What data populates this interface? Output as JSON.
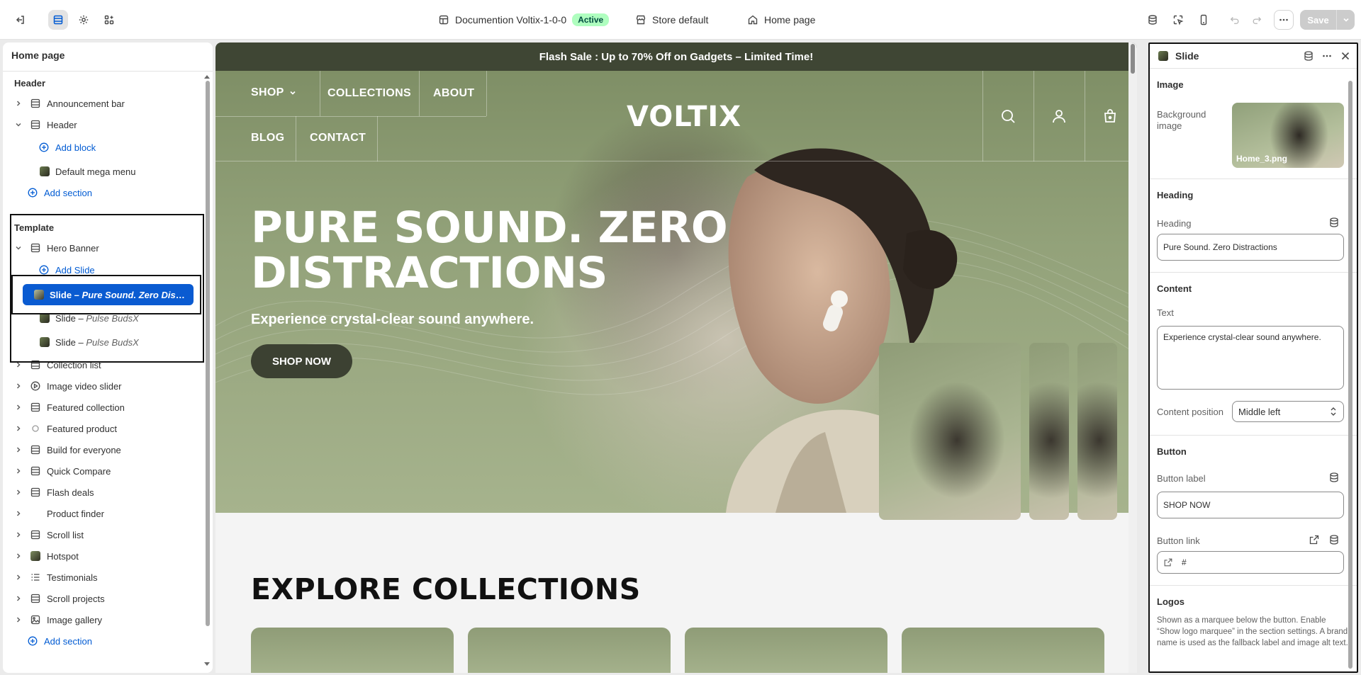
{
  "topbar": {
    "theme_name": "Documention Voltix-1-0-0",
    "theme_status": "Active",
    "store": "Store default",
    "page": "Home page",
    "save_label": "Save"
  },
  "sidebar": {
    "title": "Home page",
    "header_group": "Header",
    "header_items": [
      {
        "label": "Announcement bar"
      },
      {
        "label": "Header"
      }
    ],
    "header_children": {
      "add_block": "Add block",
      "mega_menu": "Default mega menu"
    },
    "add_section": "Add section",
    "template_group": "Template",
    "hero": "Hero Banner",
    "add_slide": "Add Slide",
    "slides": [
      {
        "prefix": "Slide – ",
        "name": "Pure Sound. Zero Distra..."
      },
      {
        "prefix": "Slide – ",
        "name": "Pulse BudsX"
      },
      {
        "prefix": "Slide – ",
        "name": "Pulse BudsX"
      }
    ],
    "sections": [
      {
        "label": "Collection list",
        "icon": "layout-icon"
      },
      {
        "label": "Image video slider",
        "icon": "play-circle-icon"
      },
      {
        "label": "Featured collection",
        "icon": "layout-icon"
      },
      {
        "label": "Featured product",
        "icon": "product-icon"
      },
      {
        "label": "Build for everyone",
        "icon": "layout-icon"
      },
      {
        "label": "Quick Compare",
        "icon": "layout-icon"
      },
      {
        "label": "Flash deals",
        "icon": "layout-icon"
      },
      {
        "label": "Product finder",
        "icon": "none"
      },
      {
        "label": "Scroll list",
        "icon": "layout-icon"
      },
      {
        "label": "Hotspot",
        "icon": "image-thumb-icon"
      },
      {
        "label": "Testimonials",
        "icon": "list-icon"
      },
      {
        "label": "Scroll projects",
        "icon": "layout-icon"
      },
      {
        "label": "Image gallery",
        "icon": "image-icon"
      }
    ],
    "add_section_2": "Add section"
  },
  "preview": {
    "flash_bar": "Flash Sale : Up to 70% Off on Gadgets – Limited Time!",
    "nav": {
      "shop": "SHOP",
      "collections": "COLLECTIONS",
      "about": "ABOUT",
      "blog": "BLOG",
      "contact": "CONTACT",
      "logo": "VOLTIX"
    },
    "hero": {
      "title": "PURE SOUND. ZERO DISTRACTIONS",
      "text": "Experience crystal-clear sound anywhere.",
      "button": "SHOP NOW"
    },
    "explore_title": "EXPLORE COLLECTIONS"
  },
  "panel": {
    "title": "Slide",
    "image_section": "Image",
    "bg_label": "Background image",
    "bg_file": "Home_3.png",
    "heading_section": "Heading",
    "heading_label": "Heading",
    "heading_value": "Pure Sound. Zero Distractions",
    "content_section": "Content",
    "text_label": "Text",
    "text_value": "Experience crystal-clear sound anywhere.",
    "position_label": "Content position",
    "position_value": "Middle left",
    "button_section": "Button",
    "button_label_label": "Button label",
    "button_label_value": "SHOP NOW",
    "button_link_label": "Button link",
    "button_link_value": "#",
    "logos_section": "Logos",
    "logos_note": "Shown as a marquee below the button. Enable “Show logo marquee” in the section settings. A brand name is used as the fallback label and image alt text."
  },
  "colors": {
    "accent_blue": "#005bd3",
    "selected_row": "#0a5bd1",
    "hero_green": "#93a27a",
    "flash_bar": "#3f4634",
    "active_badge": "#affebf"
  }
}
